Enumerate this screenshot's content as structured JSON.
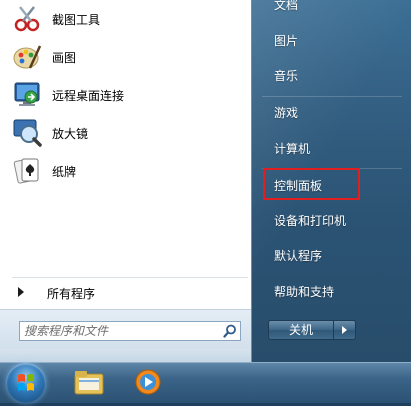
{
  "programs": [
    {
      "label": "截图工具",
      "icon": "snipping-tool-icon"
    },
    {
      "label": "画图",
      "icon": "paint-icon"
    },
    {
      "label": "远程桌面连接",
      "icon": "remote-desktop-icon"
    },
    {
      "label": "放大镜",
      "icon": "magnifier-icon"
    },
    {
      "label": "纸牌",
      "icon": "solitaire-icon"
    }
  ],
  "all_programs": "所有程序",
  "search": {
    "placeholder": "搜索程序和文件"
  },
  "right_menu": [
    {
      "label": "文档"
    },
    {
      "label": "图片"
    },
    {
      "label": "音乐"
    },
    {
      "label": "游戏"
    },
    {
      "label": "计算机"
    },
    {
      "label": "控制面板"
    },
    {
      "label": "设备和打印机"
    },
    {
      "label": "默认程序"
    },
    {
      "label": "帮助和支持"
    }
  ],
  "shutdown": {
    "label": "关机"
  },
  "highlight_color": "#e02020",
  "taskbar": {
    "items": [
      "start-orb",
      "file-explorer-icon",
      "media-player-icon"
    ]
  }
}
